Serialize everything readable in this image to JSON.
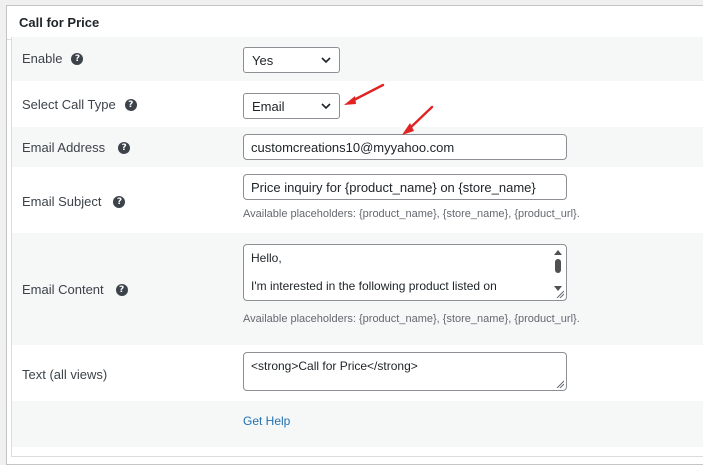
{
  "panel": {
    "title": "Call for Price"
  },
  "fields": {
    "enable": {
      "label": "Enable",
      "value": "Yes"
    },
    "call_type": {
      "label": "Select Call Type",
      "value": "Email"
    },
    "email_address": {
      "label": "Email Address",
      "value": "customcreations10@myyahoo.com"
    },
    "email_subject": {
      "label": "Email Subject",
      "value": "Price inquiry for {product_name} on {store_name}",
      "hint": "Available placeholders: {product_name}, {store_name}, {product_url}."
    },
    "email_content": {
      "label": "Email Content",
      "line1": "Hello,",
      "line2": "I'm interested in the following product listed on",
      "hint": "Available placeholders: {product_name}, {store_name}, {product_url}."
    },
    "text_all_views": {
      "label": "Text (all views)",
      "value": "<strong>Call for Price</strong>"
    }
  },
  "help_link": {
    "label": "Get Help"
  },
  "icons": {
    "help": "question-icon",
    "dropdown": "chevron-down-icon"
  },
  "colors": {
    "arrow": "#e02424",
    "link": "#2271b1",
    "help_bg": "#3c434a"
  }
}
